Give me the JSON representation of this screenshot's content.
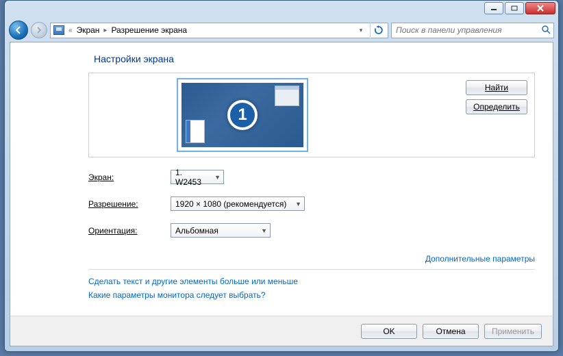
{
  "breadcrumb": {
    "seg1": "Экран",
    "seg2": "Разрешение экрана"
  },
  "search": {
    "placeholder": "Поиск в панели управления"
  },
  "page_title": "Настройки экрана",
  "monitor_number": "1",
  "buttons": {
    "find": "Найти",
    "identify": "Определить",
    "ok": "OK",
    "cancel": "Отмена",
    "apply": "Применить"
  },
  "labels": {
    "screen": "Экран:",
    "resolution": "Разрешение:",
    "orientation": "Ориентация:"
  },
  "values": {
    "screen": "1. W2453",
    "resolution": "1920 × 1080 (рекомендуется)",
    "orientation": "Альбомная"
  },
  "links": {
    "advanced": "Дополнительные параметры",
    "text_size": "Сделать текст и другие элементы больше или меньше",
    "which_params": "Какие параметры монитора следует выбрать?"
  }
}
